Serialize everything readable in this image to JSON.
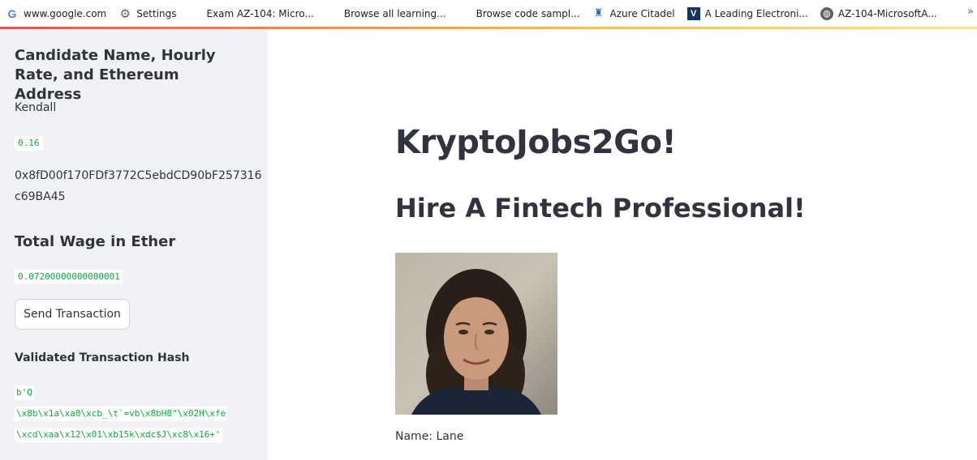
{
  "bookmarks": [
    {
      "label": "www.google.com",
      "icon": "google-icon"
    },
    {
      "label": "Settings",
      "icon": "gear-icon"
    },
    {
      "label": "Exam AZ-104: Micro...",
      "icon": "microsoft-icon"
    },
    {
      "label": "Browse all learning...",
      "icon": "microsoft-icon"
    },
    {
      "label": "Browse code sampl...",
      "icon": "microsoft-icon"
    },
    {
      "label": "Azure Citadel",
      "icon": "azure-icon"
    },
    {
      "label": "A Leading Electroni...",
      "icon": "v-logo-icon"
    },
    {
      "label": "AZ-104-MicrosoftA...",
      "icon": "globe-icon"
    }
  ],
  "bookmarks_more": "»",
  "sidebar": {
    "candidate_heading": "Candidate Name, Hourly Rate, and Ethereum Address",
    "candidate_name": "Kendall",
    "hourly_rate": "0.16",
    "eth_address_line1": "0x8fD00f170FDf3772C5ebdCD90bF257316",
    "eth_address_line2": "c69BA45",
    "wage_heading": "Total Wage in Ether",
    "total_wage": "0.07200000000000001",
    "send_button": "Send Transaction",
    "hash_heading": "Validated Transaction Hash",
    "hash_line1": "b'Q",
    "hash_line2": "\\x8b\\x1a\\xa0\\xcb_\\t`=vb\\x8bH8\"\\x02H\\xfe",
    "hash_line3": "\\xcd\\xaa\\x12\\x01\\xb15k\\xdc$J\\xc8\\x16+'"
  },
  "main": {
    "title": "KryptoJobs2Go!",
    "subtitle": "Hire A Fintech Professional!",
    "name_label": "Name: Lane"
  },
  "colors": {
    "sidebar_bg": "#f0f2f6",
    "code_green": "#09ab3b",
    "text": "#31333f",
    "accent_red": "#ff4b4b",
    "accent_yellow": "#ffbd45"
  }
}
